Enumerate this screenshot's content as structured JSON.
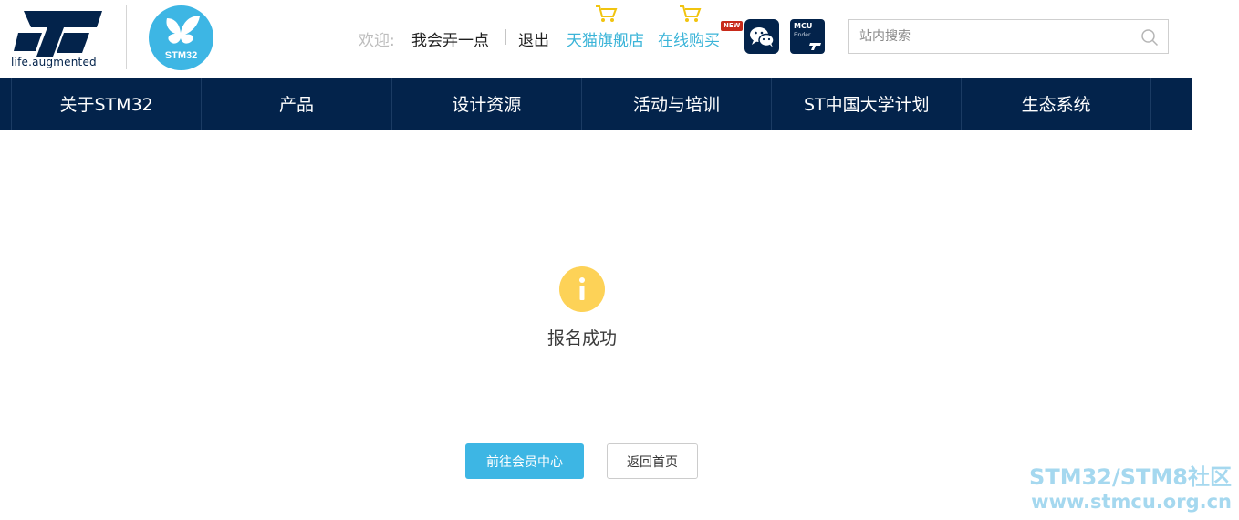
{
  "header": {
    "brand_tagline": "life.augmented",
    "welcome_label": "欢迎:",
    "username": "我会弄一点",
    "separator": "|",
    "logout_label": "退出",
    "shop_tmall_label": "天猫旗舰店",
    "shop_online_label": "在线购买",
    "new_badge": "NEW",
    "mcu_finder": {
      "title": "MCU",
      "subtitle": "Finder"
    },
    "search": {
      "placeholder": "站内搜索",
      "value": ""
    },
    "icons": [
      "st-logo",
      "stm32-butterfly-logo",
      "cart-icon",
      "wechat-icon",
      "mcu-finder-icon",
      "search-icon"
    ]
  },
  "nav": {
    "items": [
      {
        "label": "关于STM32"
      },
      {
        "label": "产品"
      },
      {
        "label": "设计资源"
      },
      {
        "label": "活动与培训"
      },
      {
        "label": "ST中国大学计划"
      },
      {
        "label": "生态系统"
      }
    ]
  },
  "main": {
    "status_icon": "info-icon",
    "message": "报名成功",
    "primary_button": "前往会员中心",
    "secondary_button": "返回首页"
  },
  "watermark": {
    "line1": "STM32/STM8社区",
    "line2": "www.stmcu.org.cn"
  },
  "colors": {
    "nav_bg": "#03234b",
    "accent": "#3db6e4",
    "link": "#3bb4d8",
    "info_icon": "#fdd257",
    "new_badge": "#c82a1a"
  }
}
